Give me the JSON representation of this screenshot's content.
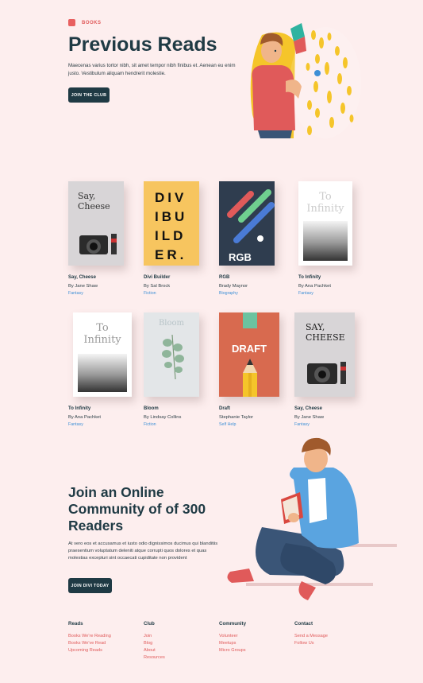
{
  "header": {
    "tag": "BOOKS",
    "title": "Previous Reads",
    "intro": "Maecenas varius tortor nibh, sit amet tempor nibh finibus et. Aenean eu enim justo. Vestibulum aliquam hendrerit molestie.",
    "cta": "JOIN THE CLUB"
  },
  "books": [
    {
      "title": "Say, Cheese",
      "author": "By Jane Shaw",
      "genre": "Fantasy",
      "cover_text": "Say,\nCheese"
    },
    {
      "title": "Divi Builder",
      "author": "By Sal Brock",
      "genre": "Fiction",
      "cover_text": "DIV\nIBU\nILD\nER."
    },
    {
      "title": "RGB",
      "author": "Brady Maynor",
      "genre": "Biography",
      "cover_text": "RGB"
    },
    {
      "title": "To Infinity",
      "author": "By Ana Pachket",
      "genre": "Fantasy",
      "cover_text": "To\nInfinity"
    },
    {
      "title": "To Infinity",
      "author": "By Ana Pachket",
      "genre": "Fantasy",
      "cover_text": "To\nInfinity"
    },
    {
      "title": "Bloom",
      "author": "By Lindsay Collins",
      "genre": "Fiction",
      "cover_text": "Bloom"
    },
    {
      "title": "Draft",
      "author": "Stephanie Taylor",
      "genre": "Self Help",
      "cover_text": "DRAFT"
    },
    {
      "title": "Say, Cheese",
      "author": "By Jane Shaw",
      "genre": "Fantasy",
      "cover_text": "SAY,\nCHEESE"
    }
  ],
  "community": {
    "title": "Join an Online Community of of 300 Readers",
    "text": "At vero eos et accusamus et iusto odio dignissimos ducimus qui blanditiis praesentium voluptatum deleniti atque corrupti quos dolores et quas molestias excepturi sint occaecati cupiditate non provident",
    "cta": "JOIN DIVI TODAY"
  },
  "footer": {
    "reads": {
      "heading": "Reads",
      "links": [
        "Books We're Reading",
        "Books We've Read",
        "Upcoming Reads"
      ]
    },
    "club": {
      "heading": "Club",
      "links": [
        "Join",
        "Blog",
        "About",
        "Resources"
      ]
    },
    "community": {
      "heading": "Community",
      "links": [
        "Volunteer",
        "Meetups",
        "Micro Groups"
      ]
    },
    "contact": {
      "heading": "Contact",
      "links": [
        "Send a Message",
        "Follow Us"
      ]
    }
  },
  "colors": {
    "accent": "#e05a5a",
    "dark": "#1f3a44",
    "link": "#3d8fd6",
    "bg": "#fdeeee"
  }
}
